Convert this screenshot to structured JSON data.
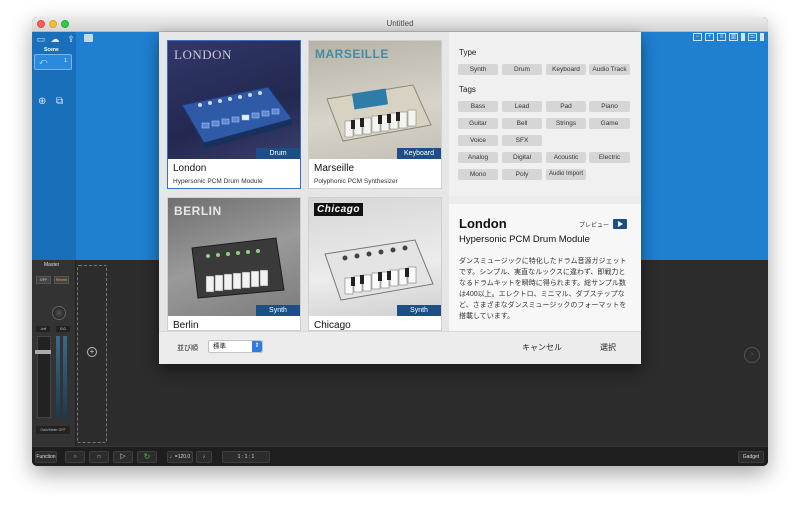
{
  "window": {
    "title": "Untitled"
  },
  "scene_panel": {
    "label": "Scene",
    "cell_number": "1"
  },
  "mixer": {
    "title": "Master",
    "btn_left": "OFF",
    "btn_right": "Reverb",
    "val_left": "-inf",
    "val_right": "0.0",
    "footer": "Gain/Meter OFF"
  },
  "transport": {
    "function_label": "Function",
    "tempo": "♩=120.0",
    "position": "1 :  1 :  1",
    "gadget_label": "Gadget"
  },
  "dialog": {
    "tiles": [
      {
        "brand": "LONDON",
        "name": "London",
        "sub": "Hypersonic PCM Drum Module",
        "tag": "Drum",
        "selected": true
      },
      {
        "brand": "MARSEILLE",
        "name": "Marseille",
        "sub": "Polyphonic PCM Synthesizer",
        "tag": "Keyboard",
        "selected": false
      },
      {
        "brand": "BERLIN",
        "name": "Berlin",
        "sub": "",
        "tag": "Synth",
        "selected": false
      },
      {
        "brand": "Chicago",
        "name": "Chicago",
        "sub": "",
        "tag": "Synth",
        "selected": false
      }
    ],
    "filters": {
      "type_heading": "Type",
      "types": [
        "Synth",
        "Drum",
        "Keyboard",
        "Audio Track"
      ],
      "tags_heading": "Tags",
      "tags": [
        "Bass",
        "Lead",
        "Pad",
        "Piano",
        "Guitar",
        "Bell",
        "Strings",
        "Game",
        "Voice",
        "SFX",
        "Analog",
        "Digital",
        "Acoustic",
        "Electric",
        "Mono",
        "Poly",
        "Audio Import"
      ]
    },
    "detail": {
      "title": "London",
      "subtitle": "Hypersonic PCM Drum Module",
      "preview_label": "プレビュー",
      "description": "ダンスミュージックに特化したドラム音源ガジェットです。シンプル、実直なルックスに違わず、即戦力となるドラムキットを瞬時に得られます。総サンプル数は400以上。エレクトロ、ミニマル、ダブステップなど、さまざまなダンスミュージックのフォーマットを搭載しています。"
    },
    "footer": {
      "sort_label": "並び順",
      "sort_value": "標準",
      "cancel_label": "キャンセル",
      "select_label": "選択"
    }
  },
  "colors": {
    "accent": "#1d4e86",
    "toolbar_blue": "#1f7fd1",
    "loop_green": "#3ec26a"
  }
}
